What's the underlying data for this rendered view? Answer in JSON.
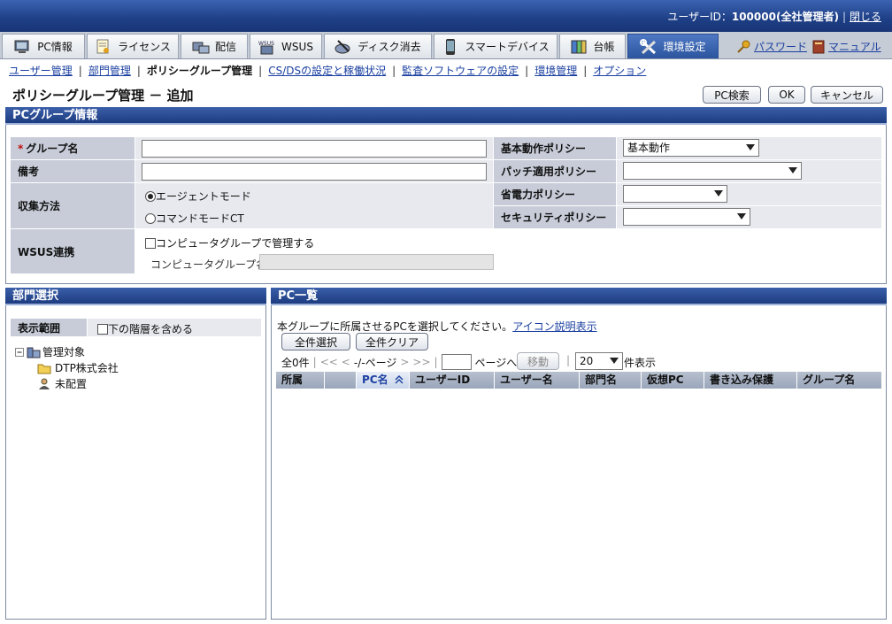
{
  "header": {
    "user_label": "ユーザーID：",
    "user_value": "100000(全社管理者)",
    "logout": "閉じる"
  },
  "tabs": [
    {
      "label": "PC情報",
      "icon": "pc-info-icon"
    },
    {
      "label": "ライセンス",
      "icon": "license-icon"
    },
    {
      "label": "配信",
      "icon": "distribution-icon"
    },
    {
      "label": "WSUS",
      "icon": "wsus-icon"
    },
    {
      "label": "ディスク消去",
      "icon": "disk-erase-icon"
    },
    {
      "label": "スマートデバイス",
      "icon": "smart-device-icon"
    },
    {
      "label": "台帳",
      "icon": "ledger-icon"
    },
    {
      "label": "環境設定",
      "icon": "settings-icon",
      "active": true
    }
  ],
  "toplinks": {
    "password": "パスワード",
    "manual": "マニュアル"
  },
  "subnav": {
    "user_mgmt": "ユーザー管理",
    "dept_mgmt": "部門管理",
    "policy_group_mgmt": "ポリシーグループ管理",
    "csds": "CS/DSの設定と稼働状況",
    "audit": "監査ソフトウェアの設定",
    "env_mgmt": "環境管理",
    "option": "オプション"
  },
  "page": {
    "title": "ポリシーグループ管理 － 追加",
    "pc_search": "PC検索",
    "ok": "OK",
    "cancel": "キャンセル"
  },
  "pc_group": {
    "header": "PCグループ情報",
    "required_mark": "*",
    "group_name_label": "グループ名",
    "group_name_value": "",
    "remarks_label": "備考",
    "remarks_value": "",
    "collect_label": "収集方法",
    "agent_mode": "エージェントモード",
    "command_mode": "コマンドモードCT",
    "wsus_label": "WSUS連携",
    "wsus_checkbox": "コンピュータグループで管理する",
    "computer_group_label": "コンピュータグループ名",
    "basic_policy_label": "基本動作ポリシー",
    "basic_policy_value": "基本動作",
    "patch_policy_label": "パッチ適用ポリシー",
    "patch_policy_value": "",
    "power_policy_label": "省電力ポリシー",
    "power_policy_value": "",
    "security_policy_label": "セキュリティポリシー",
    "security_policy_value": ""
  },
  "dept": {
    "header": "部門選択",
    "scope_label": "表示範囲",
    "include_lower": "下の階層を含める",
    "tree": {
      "root": "管理対象",
      "child1": "DTP株式会社",
      "child2": "未配置"
    }
  },
  "pclist": {
    "header": "PC一覧",
    "instruction": "本グループに所属させるPCを選択してください。",
    "icon_help": "アイコン説明表示",
    "select_all": "全件選択",
    "clear_all": "全件クリア",
    "total": "全0件",
    "nav_first": "<<",
    "nav_prev": "<",
    "page_indicator": "-/-ページ",
    "nav_next": ">",
    "nav_last": ">>",
    "page_to": "ページへ",
    "move": "移動",
    "per_page_value": "20",
    "per_page_suffix": "件表示",
    "columns": [
      "所属",
      "",
      "PC名",
      "ユーザーID",
      "ユーザー名",
      "部門名",
      "仮想PC",
      "書き込み保護",
      "グループ名"
    ]
  }
}
